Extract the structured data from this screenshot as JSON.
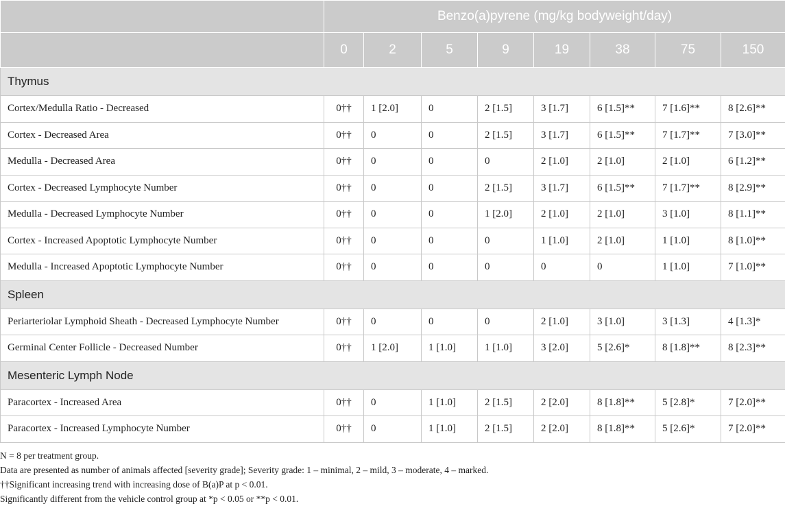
{
  "header": {
    "group_title": "Benzo(a)pyrene (mg/kg bodyweight/day)",
    "doses": [
      "0",
      "2",
      "5",
      "9",
      "19",
      "38",
      "75",
      "150"
    ]
  },
  "sections": [
    {
      "title": "Thymus",
      "rows": [
        {
          "label": "Cortex/Medulla Ratio - Decreased",
          "values": [
            "0††",
            "1 [2.0]",
            "0",
            "2 [1.5]",
            "3 [1.7]",
            "6 [1.5]**",
            "7 [1.6]**",
            "8 [2.6]**"
          ]
        },
        {
          "label": "Cortex - Decreased Area",
          "values": [
            "0††",
            "0",
            "0",
            "2 [1.5]",
            "3 [1.7]",
            "6 [1.5]**",
            "7 [1.7]**",
            "7 [3.0]**"
          ]
        },
        {
          "label": "Medulla - Decreased Area",
          "values": [
            "0††",
            "0",
            "0",
            "0",
            "2 [1.0]",
            "2 [1.0]",
            "2 [1.0]",
            "6 [1.2]**"
          ]
        },
        {
          "label": "Cortex - Decreased Lymphocyte Number",
          "values": [
            "0††",
            "0",
            "0",
            "2 [1.5]",
            "3 [1.7]",
            "6 [1.5]**",
            "7 [1.7]**",
            "8 [2.9]**"
          ]
        },
        {
          "label": "Medulla - Decreased Lymphocyte Number",
          "values": [
            "0††",
            "0",
            "0",
            "1 [2.0]",
            "2 [1.0]",
            "2 [1.0]",
            "3 [1.0]",
            "8 [1.1]**"
          ]
        },
        {
          "label": "Cortex - Increased Apoptotic Lymphocyte Number",
          "values": [
            "0††",
            "0",
            "0",
            "0",
            "1 [1.0]",
            "2 [1.0]",
            "1 [1.0]",
            "8 [1.0]**"
          ]
        },
        {
          "label": "Medulla - Increased Apoptotic Lymphocyte Number",
          "values": [
            "0††",
            "0",
            "0",
            "0",
            "0",
            "0",
            "1 [1.0]",
            "7 [1.0]**"
          ]
        }
      ]
    },
    {
      "title": "Spleen",
      "rows": [
        {
          "label": "Periarteriolar Lymphoid Sheath - Decreased Lymphocyte Number",
          "values": [
            "0††",
            "0",
            "0",
            "0",
            "2 [1.0]",
            "3 [1.0]",
            "3 [1.3]",
            "4 [1.3]*"
          ]
        },
        {
          "label": "Germinal Center Follicle - Decreased Number",
          "values": [
            "0††",
            "1 [2.0]",
            "1 [1.0]",
            "1 [1.0]",
            "3 [2.0]",
            "5 [2.6]*",
            "8 [1.8]**",
            "8 [2.3]**"
          ]
        }
      ]
    },
    {
      "title": "Mesenteric Lymph Node",
      "rows": [
        {
          "label": "Paracortex - Increased Area",
          "values": [
            "0††",
            "0",
            "1 [1.0]",
            "2 [1.5]",
            "2 [2.0]",
            "8 [1.8]**",
            "5 [2.8]*",
            "7 [2.0]**"
          ]
        },
        {
          "label": "Paracortex - Increased Lymphocyte Number",
          "values": [
            "0††",
            "0",
            "1 [1.0]",
            "2 [1.5]",
            "2 [2.0]",
            "8 [1.8]**",
            "5 [2.6]*",
            "7 [2.0]**"
          ]
        }
      ]
    }
  ],
  "footnotes": [
    "N = 8 per treatment group.",
    "Data are presented as number of animals affected [severity grade]; Severity grade: 1 – minimal, 2 – mild, 3 – moderate, 4 – marked.",
    "††Significant increasing trend with increasing dose of B(a)P at p < 0.01.",
    "Significantly different from the vehicle control group at *p < 0.05 or **p < 0.01."
  ],
  "colors": {
    "header_bg": "#cbcbcb",
    "section_bg": "#e4e4e4",
    "border": "#c8c8c8"
  }
}
